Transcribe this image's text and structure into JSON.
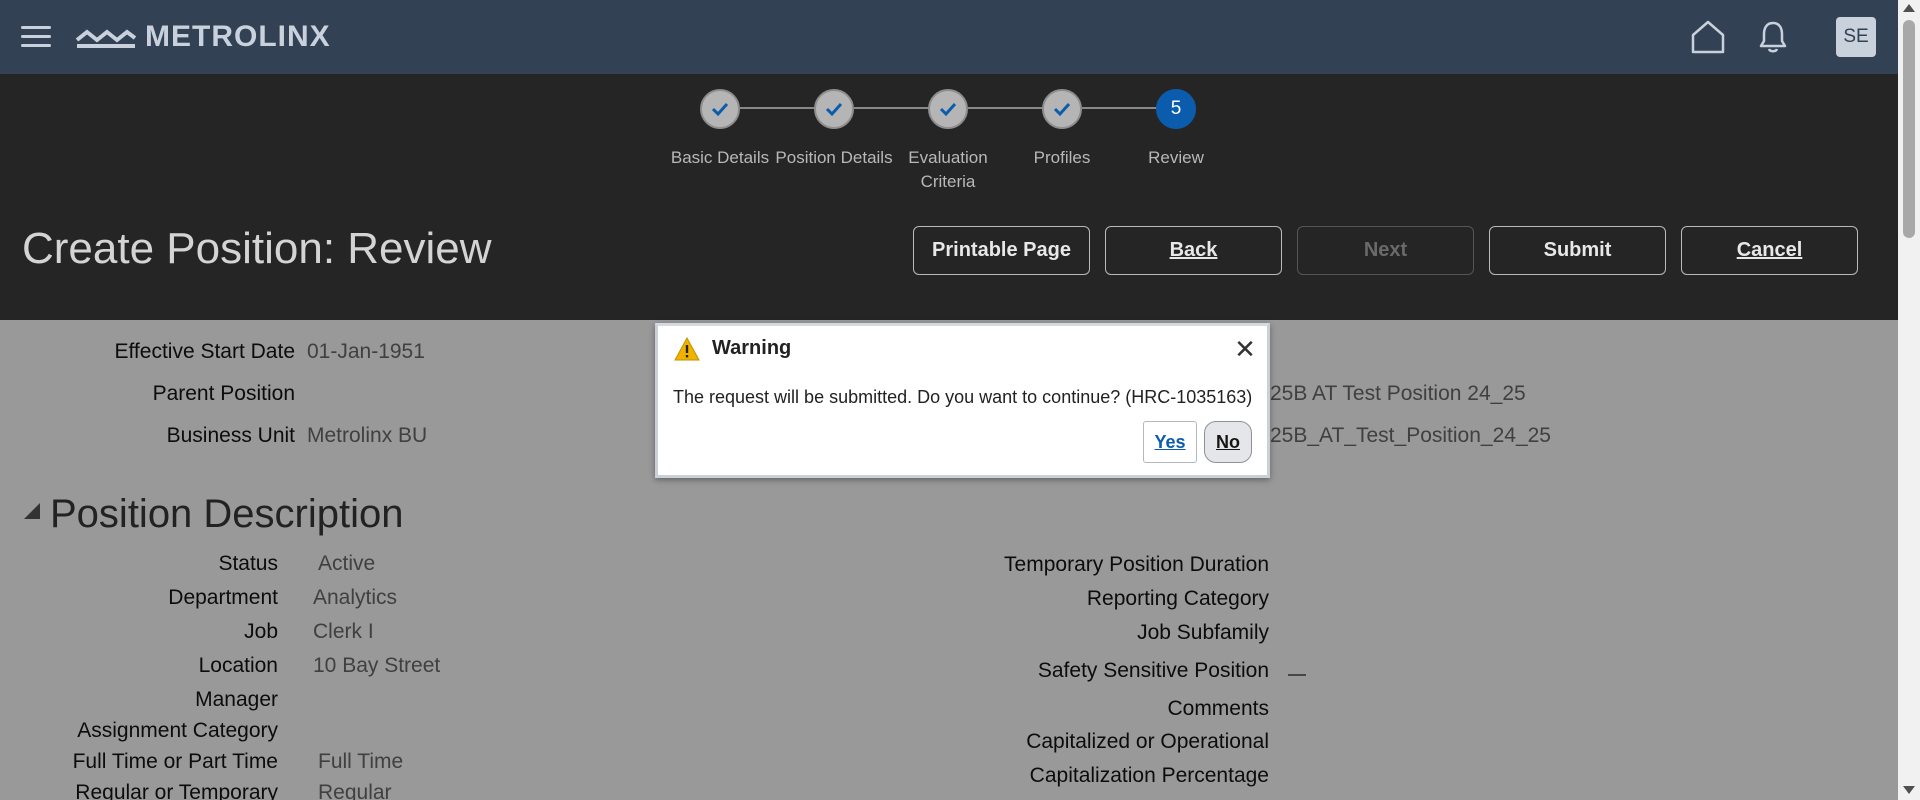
{
  "topbar": {
    "logo_text": "METROLINX",
    "avatar_initials": "SE"
  },
  "train": {
    "stops": [
      {
        "label": "Basic Details",
        "state": "complete"
      },
      {
        "label": "Position Details",
        "state": "complete"
      },
      {
        "label": "Evaluation Criteria",
        "state": "complete"
      },
      {
        "label": "Profiles",
        "state": "complete"
      },
      {
        "label": "Review",
        "number": "5",
        "state": "current"
      }
    ]
  },
  "header": {
    "title": "Create Position: Review",
    "buttons": {
      "printable": "Printable Page",
      "back": "Back",
      "next": "Next",
      "submit": "Submit",
      "cancel": "Cancel"
    }
  },
  "summary": {
    "effective_start_date_label": "Effective Start Date",
    "effective_start_date_value": "01-Jan-1951",
    "parent_position_label": "Parent Position",
    "business_unit_label": "Business Unit",
    "business_unit_value": "Metrolinx BU",
    "right_value_1": "25B AT Test Position 24_25",
    "right_value_2": "25B_AT_Test_Position_24_25"
  },
  "position_description": {
    "title": "Position Description",
    "left": [
      {
        "label": "Status",
        "value": "Active"
      },
      {
        "label": "Department",
        "value": "Analytics"
      },
      {
        "label": "Job",
        "value": "Clerk I"
      },
      {
        "label": "Location",
        "value": "10 Bay Street"
      },
      {
        "label": "Manager",
        "value": ""
      },
      {
        "label": "Assignment Category",
        "value": ""
      },
      {
        "label": "Full Time or Part Time",
        "value": "Full Time"
      },
      {
        "label": "Regular or Temporary",
        "value": "Regular"
      }
    ],
    "right": [
      {
        "label": "Temporary Position Duration"
      },
      {
        "label": "Reporting Category"
      },
      {
        "label": "Job Subfamily"
      },
      {
        "label": "Safety Sensitive Position"
      },
      {
        "label": "Comments"
      },
      {
        "label": "Capitalized or Operational"
      },
      {
        "label": "Capitalization Percentage"
      }
    ]
  },
  "dialog": {
    "title": "Warning",
    "message": "The request will be submitted. Do you want to continue? (HRC-1035163)",
    "yes_label": "Yes",
    "no_label": "No"
  },
  "colors": {
    "topbar": "#324154",
    "header_band": "#252525",
    "current_stop": "#0b5cad",
    "warning_icon": "#f0b400"
  }
}
